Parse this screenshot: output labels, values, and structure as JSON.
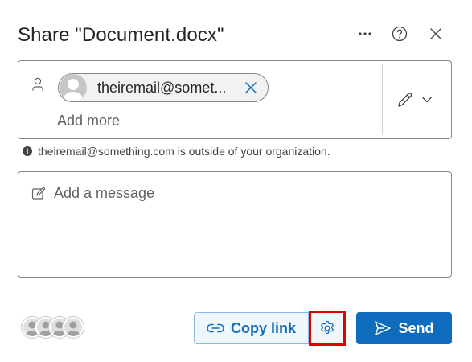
{
  "dialog": {
    "title": "Share \"Document.docx\""
  },
  "header": {
    "more_icon": "more-horizontal-icon",
    "help_icon": "help-circle-icon",
    "close_icon": "close-icon"
  },
  "recipients": {
    "chip_email": "theiremail@somet...",
    "add_more_placeholder": "Add more",
    "permission_icon": "pencil-icon"
  },
  "warning": {
    "text": "theiremail@something.com is outside of your organization."
  },
  "message": {
    "placeholder": "Add a message"
  },
  "footer": {
    "copy_link_label": "Copy link",
    "send_label": "Send",
    "settings_icon": "gear-icon"
  },
  "colors": {
    "accent": "#0f6cbd",
    "highlight": "#e00000"
  }
}
